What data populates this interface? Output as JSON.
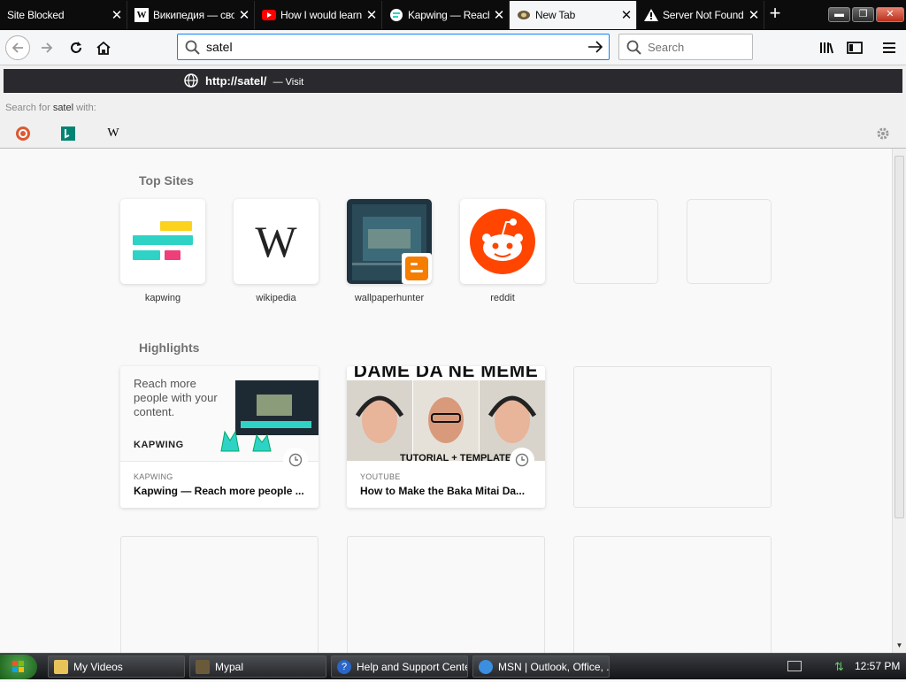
{
  "tabs": [
    {
      "title": "Site Blocked",
      "favicon": "none"
    },
    {
      "title": "Википедия — сво",
      "favicon": "wikipedia-icon"
    },
    {
      "title": "How I would learn",
      "favicon": "youtube-icon"
    },
    {
      "title": "Kapwing — Reach",
      "favicon": "kapwing-icon"
    },
    {
      "title": "New Tab",
      "favicon": "firefox-icon",
      "active": true
    },
    {
      "title": "Server Not Found",
      "favicon": "warning-icon"
    }
  ],
  "navbar": {
    "url_value": "satel",
    "search_placeholder": "Search"
  },
  "dropdown": {
    "suggestion_prefix": "http://",
    "suggestion_host": "satel",
    "suggestion_suffix": "/",
    "suggestion_action": "— Visit",
    "search_for_prefix": "Search for",
    "search_for_term": "satel",
    "search_for_suffix": "with:",
    "engines": [
      "duckduckgo-icon",
      "bing-icon",
      "wikipedia-icon"
    ]
  },
  "top_sites": {
    "heading": "Top Sites",
    "sites": [
      {
        "label": "kapwing"
      },
      {
        "label": "wikipedia"
      },
      {
        "label": "wallpaperhunter"
      },
      {
        "label": "reddit"
      },
      {
        "label": ""
      },
      {
        "label": ""
      }
    ]
  },
  "highlights": {
    "heading": "Highlights",
    "cards": [
      {
        "source": "KAPWING",
        "title": "Kapwing — Reach more people ...",
        "image_text": "Reach more people with your content.",
        "brand": "KAPWING"
      },
      {
        "source": "YOUTUBE",
        "title": "How to Make the Baka Mitai Da...",
        "image_text": "DAME DA NE MEME",
        "image_sub": "TUTORIAL + TEMPLATES"
      }
    ]
  },
  "taskbar": {
    "items": [
      "My Videos",
      "Mypal",
      "Help and Support Center",
      "MSN | Outlook, Office, ..."
    ],
    "clock": "12:57 PM"
  },
  "colors": {
    "accent": "#0a84ff",
    "reddit": "#ff4500",
    "kapwing_yellow": "#fcd21d",
    "kapwing_teal": "#2ed3c6",
    "kapwing_pink": "#ee3f78"
  }
}
